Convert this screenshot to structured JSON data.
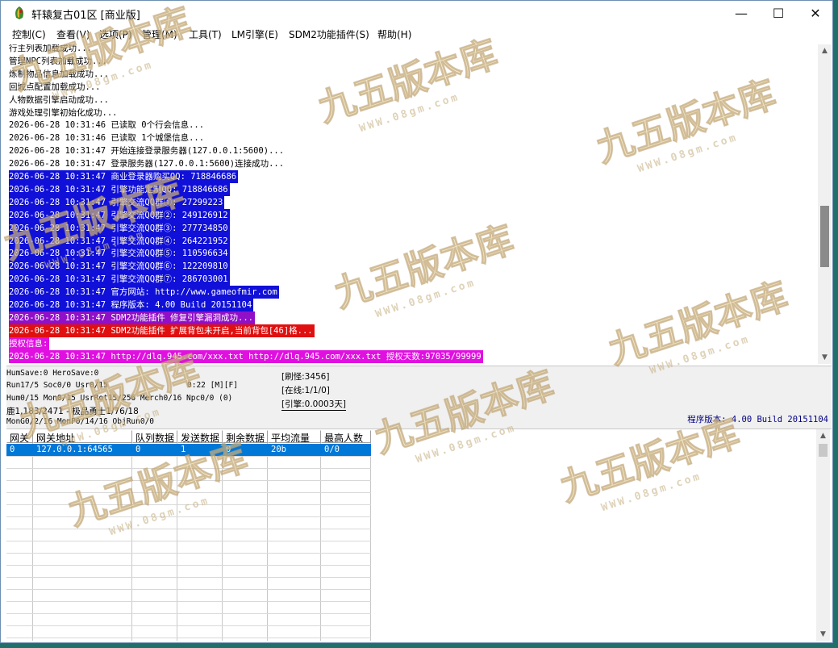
{
  "window": {
    "title": "轩辕复古01区 [商业版]",
    "controls": {
      "minimize": "—",
      "maximize": "☐",
      "close": "✕"
    }
  },
  "menu": [
    "控制(C)",
    "查看(V)",
    "选项(P)",
    "管理(M)",
    "工具(T)",
    "LM引擎(E)",
    "SDM2功能插件(S)",
    "帮助(H)"
  ],
  "log_lines": [
    {
      "text": "行主列表加载成功...",
      "bg": "#ffffff",
      "fg": "#000000"
    },
    {
      "text": "管理NPC列表加载成功...",
      "bg": "#ffffff",
      "fg": "#000000"
    },
    {
      "text": "炼制物品信息加载成功...",
      "bg": "#ffffff",
      "fg": "#000000"
    },
    {
      "text": "回城点配置加载成功...",
      "bg": "#ffffff",
      "fg": "#000000"
    },
    {
      "text": "人物数据引擎启动成功...",
      "bg": "#ffffff",
      "fg": "#000000"
    },
    {
      "text": "游戏处理引擎初始化成功...",
      "bg": "#ffffff",
      "fg": "#000000"
    },
    {
      "text": "2026-06-28 10:31:46 已读取 0个行会信息...",
      "bg": "#ffffff",
      "fg": "#000000"
    },
    {
      "text": "2026-06-28 10:31:46 已读取 1个城堡信息...",
      "bg": "#ffffff",
      "fg": "#000000"
    },
    {
      "text": "2026-06-28 10:31:47 开始连接登录服务器(127.0.0.1:5600)...",
      "bg": "#ffffff",
      "fg": "#000000"
    },
    {
      "text": "2026-06-28 10:31:47 登录服务器(127.0.0.1:5600)连接成功...",
      "bg": "#ffffff",
      "fg": "#000000"
    },
    {
      "text": "2026-06-28 10:31:47 商业登录器购买QQ: 718846686",
      "bg": "#1010d8",
      "fg": "#ffffff"
    },
    {
      "text": "2026-06-28 10:31:47 引擎功能定制QQ: 718846686",
      "bg": "#1010d8",
      "fg": "#ffffff"
    },
    {
      "text": "2026-06-28 10:31:47 引擎交流QQ群①: 27299223",
      "bg": "#1010d8",
      "fg": "#ffffff"
    },
    {
      "text": "2026-06-28 10:31:47 引擎交流QQ群②: 249126912",
      "bg": "#1010d8",
      "fg": "#ffffff"
    },
    {
      "text": "2026-06-28 10:31:47 引擎交流QQ群③: 277734850",
      "bg": "#1010d8",
      "fg": "#ffffff"
    },
    {
      "text": "2026-06-28 10:31:47 引擎交流QQ群④: 264221952",
      "bg": "#1010d8",
      "fg": "#ffffff"
    },
    {
      "text": "2026-06-28 10:31:47 引擎交流QQ群⑤: 110596634",
      "bg": "#1010d8",
      "fg": "#ffffff"
    },
    {
      "text": "2026-06-28 10:31:47 引擎交流QQ群⑥: 122209810",
      "bg": "#1010d8",
      "fg": "#ffffff"
    },
    {
      "text": "2026-06-28 10:31:47 引擎交流QQ群⑦: 286703001",
      "bg": "#1010d8",
      "fg": "#ffffff"
    },
    {
      "text": "2026-06-28 10:31:47 官方网站: http://www.gameofmir.com",
      "bg": "#1010d8",
      "fg": "#ffffff"
    },
    {
      "text": "2026-06-28 10:31:47 程序版本: 4.00 Build 20151104",
      "bg": "#1010d8",
      "fg": "#ffffff"
    },
    {
      "text": "2026-06-28 10:31:47 SDM2功能插件 修复引擎漏洞成功...",
      "bg": "#9010c8",
      "fg": "#ffffff"
    },
    {
      "text": "2026-06-28 10:31:47 SDM2功能插件 扩展背包未开启,当前背包[46]格...",
      "bg": "#e01010",
      "fg": "#ffffff"
    },
    {
      "text": "授权信息:",
      "bg": "#e010e0",
      "fg": "#ffffff"
    },
    {
      "text": "2026-06-28 10:31:47 http://dlq.945.com/xxx.txt http://dlq.945.com/xxx.txt 授权天数:97035/99999",
      "bg": "#e010e0",
      "fg": "#ffffff"
    }
  ],
  "status": {
    "line1": "HumSave:0 HeroSave:0",
    "line2": "Run17/5 Soc0/0 Usr0/15",
    "timer": "0:22 [M][F]",
    "line3": "Hum0/15 Mon0/15 UsrRot15/256 Merch0/16 Npc0/0 (0)",
    "line4": "鹿1,183/2471 - 极品勇士1/76/18",
    "line5": "MonG0/2/16 MonP0/14/16 ObjRun0/0",
    "refresh": "[刷怪:3456]",
    "online": "[在线:1/1/0]",
    "engine": "[引擎:0.0003天]",
    "version": "程序版本: 4.00 Build 20151104"
  },
  "grid": {
    "columns": [
      "网关",
      "网关地址",
      "队列数据",
      "发送数据",
      "剩余数据",
      "平均流量",
      "最高人数"
    ],
    "rows": [
      [
        "0",
        "127.0.0.1:64565",
        "0",
        "1",
        "0",
        "20b",
        "0/0"
      ]
    ]
  },
  "watermark": {
    "text": "九五版本库",
    "subtext": "WWW.08gm.com"
  }
}
